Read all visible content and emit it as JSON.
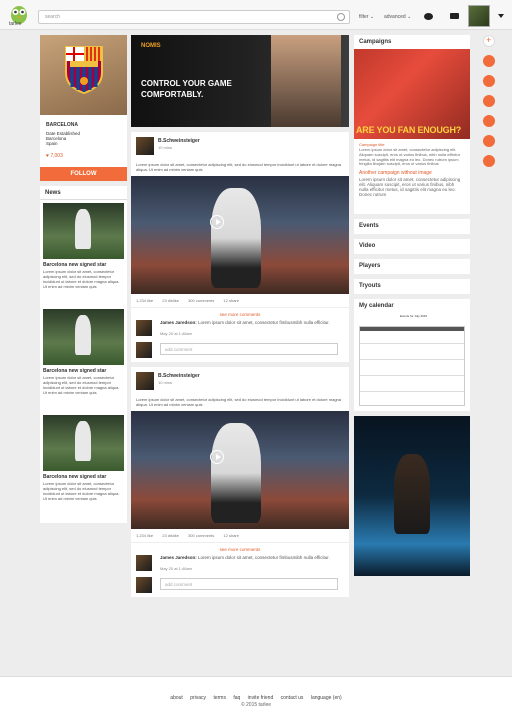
{
  "app": {
    "logo_text": "tarlee"
  },
  "header": {
    "search_placeholder": "search",
    "filter": "filter ⌄",
    "advanced": "advanced ⌄"
  },
  "club": {
    "name": "BARCELONA",
    "line1": "Date Established",
    "line2": "Barcelona",
    "line3": "Spain",
    "likes": "7,003",
    "follow": "FOLLOW"
  },
  "news": {
    "heading": "News",
    "items": [
      {
        "title": "Barcelona new signed star",
        "text": "Lorem ipsum dolor sit amet, consectetur adipiscing elit, sed do eiusmod tempor incididunt ut labore et dolore magna aliqua. Ut enim ad minim veniam quis"
      },
      {
        "title": "Barcelona new signed star",
        "text": "Lorem ipsum dolor sit amet, consectetur adipiscing elit, sed do eiusmod tempor incididunt ut labore et dolore magna aliqua. Ut enim ad minim veniam quis"
      },
      {
        "title": "Barcelona new signed star",
        "text": "Lorem ipsum dolor sit amet, consectetur adipiscing elit, sed do eiusmod tempor incididunt ut labore et dolore magna aliqua. Ut enim ad minim veniam quis"
      }
    ]
  },
  "banner": {
    "brand": "NOMIS",
    "headline": "CONTROL YOUR GAME COMFORTABLY."
  },
  "posts": [
    {
      "author": "B.Schweinsteiger",
      "time": "10 mins",
      "text": "Lorem ipsum dolor sit amet, consectetur adipiscing elit, sed do eiusmod tempor incididunt ut labore et dolore magna aliqua. Ut enim ad minim veniam quis",
      "likes": "1,234 like",
      "dislikes": "23 dislike",
      "comments": "300 comments",
      "shares": "12 share",
      "see_more": "see more comments",
      "comment": {
        "author": "James Jaredson:",
        "text": "Lorem ipsum dolor sit amet, consectetur fimbusmibh nulla efficitur.",
        "time": "May 20 at 1:46am"
      },
      "add_placeholder": "add comment"
    },
    {
      "author": "B.Schweinsteiger",
      "time": "10 mins",
      "text": "Lorem ipsum dolor sit amet, consectetur adipiscing elit, sed do eiusmod tempor incididunt ut labore et dolore magna aliqua. Ut enim ad minim veniam quis",
      "likes": "1,234 like",
      "dislikes": "23 dislike",
      "comments": "300 comments",
      "shares": "12 share",
      "see_more": "see more comments",
      "comment": {
        "author": "James Jaredson:",
        "text": "Lorem ipsum dolor sit amet, consectetur fimbusmibh nulla efficitur.",
        "time": "May 20 at 1:46am"
      },
      "add_placeholder": "add comment"
    }
  ],
  "campaigns": {
    "heading": "Campaigns",
    "image_text": "ARE YOU FAN ENOUGH?",
    "link": "Campaign title",
    "desc": "Lorem ipsum dolor sit amet, consectetur adipiscing elit. Aliquam suscipit, eros ut varius finibus, nibh nulla efficitur metus, id sagittis elit magna eu leo. Donec rutrum ipsum fringilla libujam suscipit, eros ut varius finibus",
    "title2": "Another campaign without image",
    "desc2": "Lorem ipsum dolor sit amet, consectetur adipiscing elit. Aliquam suscipit, eros ut varius finibus, nibh nulla efficitur metus, id sagittis elit magna eu leo. Donec rutrum"
  },
  "sections": [
    "Events",
    "Video",
    "Players",
    "Tryouts"
  ],
  "calendar": {
    "heading": "My calendar",
    "title": "Events for July 2015"
  },
  "footer": {
    "links": [
      "about",
      "privacy",
      "terms",
      "faq",
      "invite friend",
      "contact us",
      "language (en)"
    ],
    "copyright": "© 2015 tarlee"
  }
}
